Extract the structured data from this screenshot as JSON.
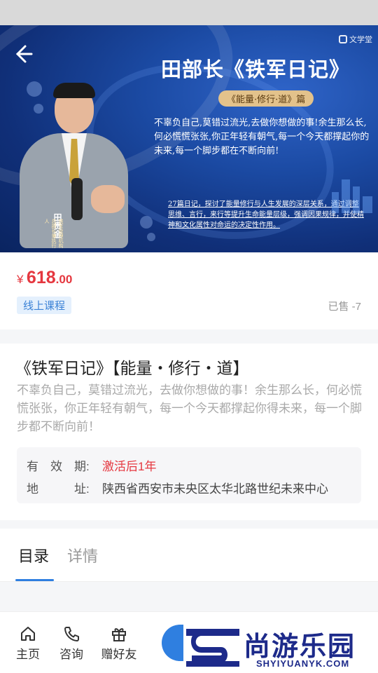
{
  "banner": {
    "title": "田部长《铁军日记》",
    "tag": "《能量·修行·道》篇",
    "quote": "不辜负自己,莫错过流光,去做你想做的事!余生那么长,何必慌慌张张,你正年轻有朝气,每一个今天都撑起你的未来,每一个脚步都在不断向前!",
    "description": "27篇日记，探讨了能量修行与人生发展的深层关系，通过调整思维、言行，来行等提升生命能量层级，强调因果规律，并使精神和文化属性对命运的决定性作用。",
    "person_name": "田贵金",
    "person_title": "铁军管理机构总部长兼执行人",
    "logo_text": "文学堂"
  },
  "product": {
    "price_symbol": "¥",
    "price_integer": "618",
    "price_decimal": ".00",
    "type_tag": "线上课程",
    "sold": "已售 -7"
  },
  "course": {
    "title": "《铁军日记》【能量・修行・道】",
    "subtitle": "不辜负自己，莫错过流光，去做你想做的事！余生那么长，何必慌慌张张，你正年轻有朝气，每一个今天都撑起你得未来，每一个脚步都不断向前！",
    "validity_label": "有　效　期:",
    "validity_value": "激活后1年",
    "address_label": "地　　　址:",
    "address_value": "陕西省西安市未央区太华北路世纪未来中心"
  },
  "tabs": {
    "catalog": "目录",
    "details": "详情"
  },
  "bottom_nav": {
    "home": "主页",
    "consult": "咨询",
    "gift": "赠好友"
  },
  "watermark": {
    "cn": "尚游乐园",
    "en": "SHYIYUANYK.COM"
  },
  "colors": {
    "accent": "#2f7fe0",
    "price": "#e5373f",
    "tag_bg": "#e4f0fd",
    "watermark": "#1d2a8a"
  }
}
